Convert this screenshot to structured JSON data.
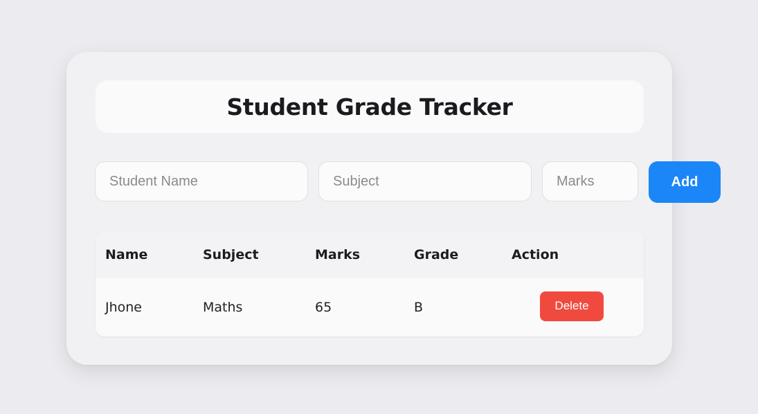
{
  "app": {
    "title": "Student Grade Tracker"
  },
  "form": {
    "name_placeholder": "Student Name",
    "subject_placeholder": "Subject",
    "marks_placeholder": "Marks",
    "add_label": "Add"
  },
  "table": {
    "headers": [
      "Name",
      "Subject",
      "Marks",
      "Grade",
      "Action"
    ],
    "rows": [
      {
        "name": "Jhone",
        "subject": "Maths",
        "marks": "65",
        "grade": "B",
        "action_label": "Delete"
      }
    ]
  },
  "colors": {
    "add_button": "#1a86f7",
    "delete_button": "#f04a3f",
    "background": "#ebebf0",
    "card": "#f1f1f4"
  }
}
